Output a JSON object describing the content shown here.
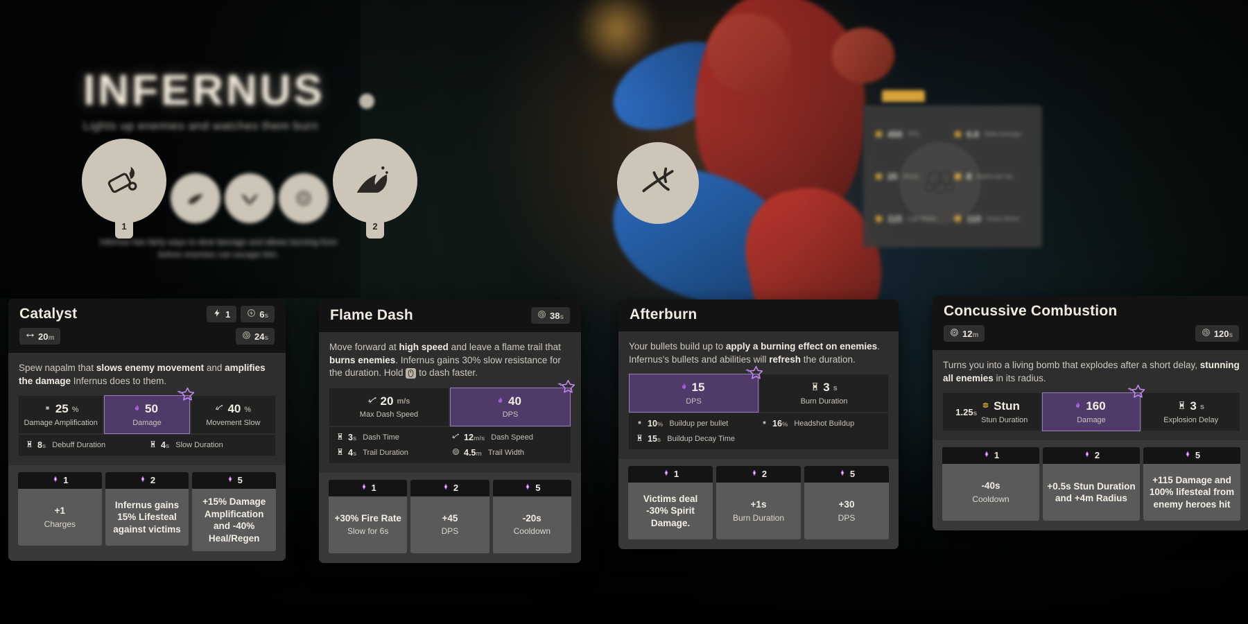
{
  "hero": {
    "name": "INFERNUS",
    "subtitle": "Lights up enemies and watches them burn",
    "description": "Infernus has fairly ways to deal damage and allows burning from before enemies can escape him.",
    "ability_pins": [
      "1",
      "2"
    ],
    "stat_panel": [
      {
        "value": "456",
        "label": "DPS"
      },
      {
        "value": "6.6",
        "label": "Bullet Damage"
      },
      {
        "value": "20",
        "label": "Ammo"
      },
      {
        "value": "8",
        "label": "Bullets per sec"
      },
      {
        "value": "115",
        "label": "Light Melee"
      },
      {
        "value": "110",
        "label": "Heavy Melee"
      }
    ]
  },
  "abilities": [
    {
      "id": "catalyst",
      "title": "Catalyst",
      "header_badges": [
        {
          "icon": "charges-icon",
          "value": "1",
          "unit": ""
        },
        {
          "icon": "charge-cooldown-icon",
          "value": "6",
          "unit": "s"
        }
      ],
      "header_badges_row2_left": [
        {
          "icon": "range-icon",
          "value": "20",
          "unit": "m"
        }
      ],
      "header_badges_row2_right": [
        {
          "icon": "cooldown-icon",
          "value": "24",
          "unit": "s"
        }
      ],
      "description_html": "Spew napalm that <b>slows enemy movement</b> and <b>amplifies the damage</b> Infernus does to them.",
      "main_stats": [
        {
          "icon": "square-icon",
          "value": "25",
          "unit": "%",
          "label": "Damage Amplification",
          "highlight": false
        },
        {
          "icon": "spirit-icon",
          "value": "50",
          "unit": "",
          "label": "Damage",
          "highlight": true
        },
        {
          "icon": "slow-icon",
          "value": "40",
          "unit": "%",
          "label": "Movement Slow",
          "highlight": false
        }
      ],
      "sub_stats": [
        {
          "icon": "hourglass-icon",
          "value": "8",
          "unit": "s",
          "label": "Debuff Duration"
        },
        {
          "icon": "hourglass-icon",
          "value": "4",
          "unit": "s",
          "label": "Slow Duration"
        }
      ],
      "upgrades": [
        {
          "cost": "1",
          "title": "+1",
          "sub": "Charges"
        },
        {
          "cost": "2",
          "title": "Infernus gains 15% Lifesteal against victims",
          "sub": ""
        },
        {
          "cost": "5",
          "title": "+15% Damage Amplification and -40% Heal/Regen",
          "sub": ""
        }
      ]
    },
    {
      "id": "flame-dash",
      "title": "Flame Dash",
      "header_badges": [
        {
          "icon": "cooldown-icon",
          "value": "38",
          "unit": "s"
        }
      ],
      "header_badges_row2_left": [],
      "header_badges_row2_right": [],
      "description_html": "Move forward at <b>high speed</b> and leave a flame trail that <b>burns enemies</b>. Infernus gains 30% slow resistance for the duration. Hold [MOUSE] to dash faster.",
      "main_stats": [
        {
          "icon": "speed-icon",
          "value": "20",
          "unit": "m/s",
          "label": "Max Dash Speed",
          "highlight": false
        },
        {
          "icon": "spirit-icon",
          "value": "40",
          "unit": "",
          "label": "DPS",
          "highlight": true
        }
      ],
      "sub_stats": [
        {
          "icon": "hourglass-icon",
          "value": "3",
          "unit": "s",
          "label": "Dash Time"
        },
        {
          "icon": "speed-icon",
          "value": "12",
          "unit": "m/s",
          "label": "Dash Speed"
        },
        {
          "icon": "hourglass-icon",
          "value": "4",
          "unit": "s",
          "label": "Trail Duration"
        },
        {
          "icon": "radius-icon",
          "value": "4.5",
          "unit": "m",
          "label": "Trail Width"
        }
      ],
      "upgrades": [
        {
          "cost": "1",
          "title": "+30% Fire Rate",
          "sub": "Slow for 6s"
        },
        {
          "cost": "2",
          "title": "+45",
          "sub": "DPS"
        },
        {
          "cost": "5",
          "title": "-20s",
          "sub": "Cooldown"
        }
      ]
    },
    {
      "id": "afterburn",
      "title": "Afterburn",
      "header_badges": [],
      "header_badges_row2_left": [],
      "header_badges_row2_right": [],
      "description_html": "Your bullets build up to <b>apply a burning effect on enemies</b>. Infernus's bullets and abilities will <b>refresh</b> the duration.",
      "main_stats": [
        {
          "icon": "spirit-icon",
          "value": "15",
          "unit": "",
          "label": "DPS",
          "highlight": true
        },
        {
          "icon": "hourglass-icon",
          "value": "3",
          "unit": "s",
          "label": "Burn Duration",
          "highlight": false
        }
      ],
      "sub_stats": [
        {
          "icon": "square-icon",
          "value": "10",
          "unit": "%",
          "label": "Buildup per bullet"
        },
        {
          "icon": "square-icon",
          "value": "16",
          "unit": "%",
          "label": "Headshot Buildup"
        },
        {
          "icon": "hourglass-icon",
          "value": "15",
          "unit": "s",
          "label": "Buildup Decay Time"
        }
      ],
      "upgrades": [
        {
          "cost": "1",
          "title": "Victims deal -30% Spirit Damage.",
          "sub": ""
        },
        {
          "cost": "2",
          "title": "+1s",
          "sub": "Burn Duration"
        },
        {
          "cost": "5",
          "title": "+30",
          "sub": "DPS"
        }
      ]
    },
    {
      "id": "concussive-combustion",
      "title": "Concussive Combustion",
      "header_badges": [],
      "header_badges_row2_left": [
        {
          "icon": "radius-icon",
          "value": "12",
          "unit": "m"
        }
      ],
      "header_badges_row2_right": [
        {
          "icon": "cooldown-icon",
          "value": "120",
          "unit": "s"
        }
      ],
      "description_html": "Turns you into a living bomb that explodes after a short delay, <b>stunning all enemies</b> in its radius.",
      "main_stats": [
        {
          "icon": "stun-icon",
          "value": "Stun",
          "unit": "",
          "label": "Stun Duration",
          "prefix": "1.25",
          "prefix_unit": "s",
          "highlight": false
        },
        {
          "icon": "spirit-icon",
          "value": "160",
          "unit": "",
          "label": "Damage",
          "highlight": true
        },
        {
          "icon": "hourglass-icon",
          "value": "3",
          "unit": "s",
          "label": "Explosion Delay",
          "highlight": false
        }
      ],
      "sub_stats": [],
      "upgrades": [
        {
          "cost": "1",
          "title": "-40s",
          "sub": "Cooldown"
        },
        {
          "cost": "2",
          "title": "+0.5s Stun Duration and +4m Radius",
          "sub": ""
        },
        {
          "cost": "5",
          "title": "+115 Damage and 100% lifesteal from enemy heroes hit",
          "sub": ""
        }
      ]
    }
  ],
  "colors": {
    "highlight_purple": "#503a69",
    "highlight_border": "#9a7ec0",
    "card_bg": "#2e2e2e",
    "header_bg": "#131313",
    "upgrade_bg": "#5a5a5a",
    "gold": "#d6a23a"
  }
}
